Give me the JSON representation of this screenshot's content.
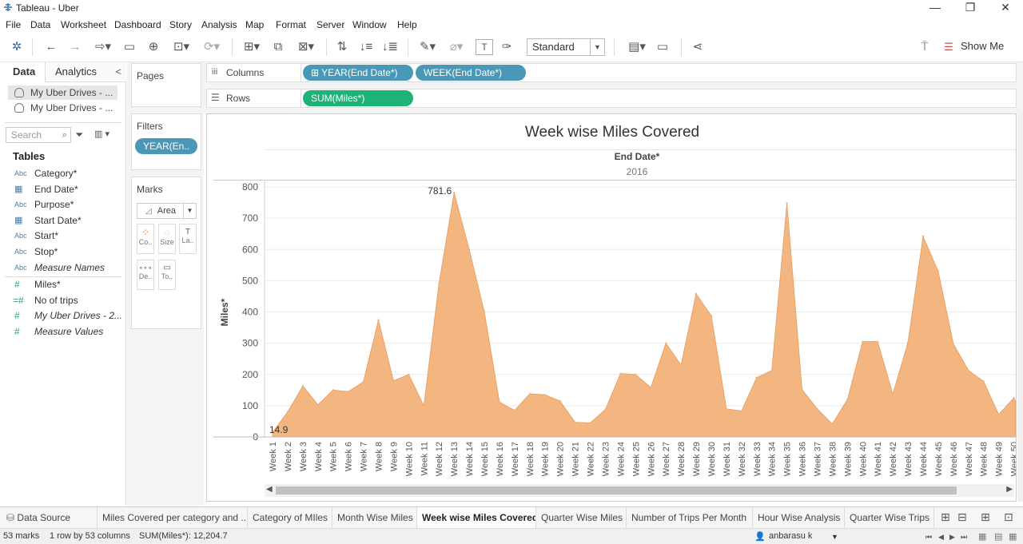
{
  "window": {
    "title": "Tableau - Uber",
    "minimize": "—",
    "restore": "❐",
    "close": "✕"
  },
  "menu": [
    "File",
    "Data",
    "Worksheet",
    "Dashboard",
    "Story",
    "Analysis",
    "Map",
    "Format",
    "Server",
    "Window",
    "Help"
  ],
  "toolbar": {
    "fit": "Standard",
    "show_me": "Show Me"
  },
  "data_pane": {
    "tab_data": "Data",
    "tab_analytics": "Analytics",
    "collapse": "<",
    "datasources": [
      "My Uber Drives - ...",
      "My Uber Drives - ..."
    ],
    "search_placeholder": "Search",
    "tables_heading": "Tables",
    "dimensions": [
      {
        "type": "Abc",
        "name": "Category*"
      },
      {
        "type": "date",
        "name": "End Date*"
      },
      {
        "type": "Abc",
        "name": "Purpose*"
      },
      {
        "type": "date",
        "name": "Start Date*"
      },
      {
        "type": "Abc",
        "name": "Start*"
      },
      {
        "type": "Abc",
        "name": "Stop*"
      },
      {
        "type": "Abc",
        "name": "Measure Names"
      }
    ],
    "measures": [
      {
        "type": "#",
        "name": "Miles*"
      },
      {
        "type": "=#",
        "name": "No of trips"
      },
      {
        "type": "#",
        "name": "My Uber Drives - 2..."
      },
      {
        "type": "#",
        "name": "Measure Values"
      }
    ]
  },
  "cards": {
    "pages": "Pages",
    "filters": "Filters",
    "filter_pill": "YEAR(En..",
    "marks": "Marks",
    "mark_type": "Area",
    "mark_buttons": [
      "Co..",
      "Size",
      "La..",
      "De..",
      "To.."
    ]
  },
  "shelves": {
    "columns_label": "Columns",
    "rows_label": "Rows",
    "columns_pills": [
      "⊞ YEAR(End Date*)",
      "WEEK(End Date*)"
    ],
    "rows_pills": [
      "SUM(Miles*)"
    ]
  },
  "view": {
    "title": "Week wise Miles Covered",
    "column_header": "End Date*",
    "year": "2016",
    "label_max": "781.6",
    "label_min": "14.9"
  },
  "chart_data": {
    "type": "area",
    "title": "Week wise Miles Covered",
    "xlabel": "End Date*",
    "ylabel": "Miles*",
    "ylim": [
      0,
      800
    ],
    "yticks": [
      0,
      100,
      200,
      300,
      400,
      500,
      600,
      700,
      800
    ],
    "grid": true,
    "color": "#F2B27A",
    "categories": [
      "Week 1",
      "Week 2",
      "Week 3",
      "Week 4",
      "Week 5",
      "Week 6",
      "Week 7",
      "Week 8",
      "Week 9",
      "Week 10",
      "Week 11",
      "Week 12",
      "Week 13",
      "Week 14",
      "Week 15",
      "Week 16",
      "Week 17",
      "Week 18",
      "Week 19",
      "Week 20",
      "Week 21",
      "Week 22",
      "Week 23",
      "Week 24",
      "Week 25",
      "Week 26",
      "Week 27",
      "Week 28",
      "Week 29",
      "Week 30",
      "Week 31",
      "Week 32",
      "Week 33",
      "Week 34",
      "Week 35",
      "Week 36",
      "Week 37",
      "Week 38",
      "Week 39",
      "Week 40",
      "Week 41",
      "Week 42",
      "Week 43",
      "Week 44",
      "Week 45",
      "Week 46",
      "Week 47",
      "Week 48",
      "Week 49",
      "Week 50"
    ],
    "values": [
      14.9,
      80,
      163,
      103,
      150,
      145,
      176,
      374,
      180,
      200,
      100,
      490,
      781.6,
      600,
      400,
      112,
      85,
      138,
      135,
      115,
      47,
      45,
      88,
      203,
      200,
      158,
      300,
      230,
      458,
      388,
      90,
      83,
      190,
      213,
      748,
      152,
      90,
      42,
      120,
      305,
      305,
      137,
      303,
      642,
      530,
      298,
      213,
      178,
      72,
      125
    ],
    "data_labels": {
      "Week 1": "14.9",
      "Week 13": "781.6"
    }
  },
  "sheet_tabs": [
    "Data Source",
    "Miles Covered per category and ...",
    "Category of MIles",
    "Month Wise Miles",
    "Week wise Miles Covered",
    "Quarter Wise Miles",
    "Number of Trips Per Month",
    "Hour Wise Analysis",
    "Quarter Wise Trips"
  ],
  "active_sheet": "Week wise Miles Covered",
  "status": {
    "marks": "53 marks",
    "dims": "1 row by 53 columns",
    "sum": "SUM(Miles*): 12,204.7",
    "user": "anbarasu k"
  }
}
